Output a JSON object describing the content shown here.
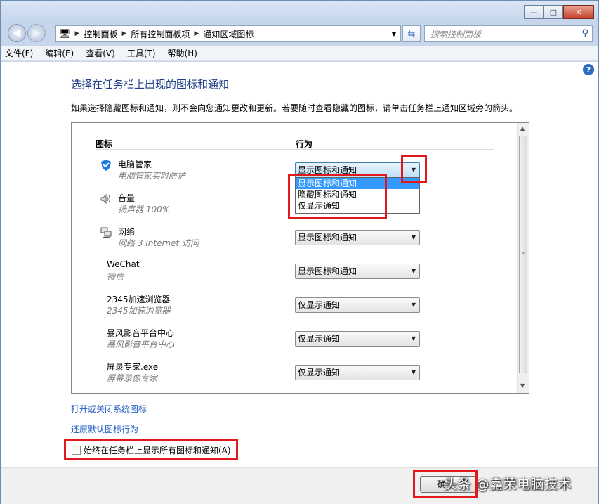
{
  "window": {
    "minimize_glyph": "—",
    "maximize_glyph": "□",
    "close_glyph": "✕"
  },
  "nav": {
    "breadcrumb": [
      "控制面板",
      "所有控制面板项",
      "通知区域图标"
    ],
    "search_placeholder": "搜索控制面板"
  },
  "menu": [
    "文件(F)",
    "编辑(E)",
    "查看(V)",
    "工具(T)",
    "帮助(H)"
  ],
  "main": {
    "heading": "选择在任务栏上出现的图标和通知",
    "description": "如果选择隐藏图标和通知，则不会向您通知更改和更新。若要随时查看隐藏的图标，请单击任务栏上通知区域旁的箭头。",
    "col_icon": "图标",
    "col_behavior": "行为",
    "rows": [
      {
        "name": "电脑管家",
        "sub": "电脑管家实时防护",
        "behavior": "显示图标和通知",
        "icon": "shield-icon"
      },
      {
        "name": "音量",
        "sub": "扬声器 100%",
        "behavior": "显示图标和通知",
        "icon": "speaker-icon"
      },
      {
        "name": "网络",
        "sub": "网络 3 Internet 访问",
        "behavior": "显示图标和通知",
        "icon": "network-icon"
      },
      {
        "name": "WeChat",
        "sub": "微信",
        "behavior": "显示图标和通知",
        "icon": ""
      },
      {
        "name": "2345加速浏览器",
        "sub": "2345加速浏览器",
        "behavior": "仅显示通知",
        "icon": ""
      },
      {
        "name": "暴风影音平台中心",
        "sub": "暴风影音平台中心",
        "behavior": "仅显示通知",
        "icon": ""
      },
      {
        "name": "屏录专家.exe",
        "sub": "屏幕录像专家",
        "behavior": "仅显示通知",
        "icon": ""
      }
    ],
    "dropdown_options": [
      "显示图标和通知",
      "隐藏图标和通知",
      "仅显示通知"
    ],
    "link_system_icons": "打开或关闭系统图标",
    "link_restore": "还原默认图标行为",
    "always_show_label": "始终在任务栏上显示所有图标和通知(A)",
    "always_show_checked": false
  },
  "footer": {
    "ok_label": "确",
    "watermark": "头条 @鑫荣电脑技术"
  },
  "colors": {
    "highlight": "#e0191d",
    "heading": "#1e3f8a",
    "link": "#1f5ac2",
    "selection": "#3399ff"
  }
}
